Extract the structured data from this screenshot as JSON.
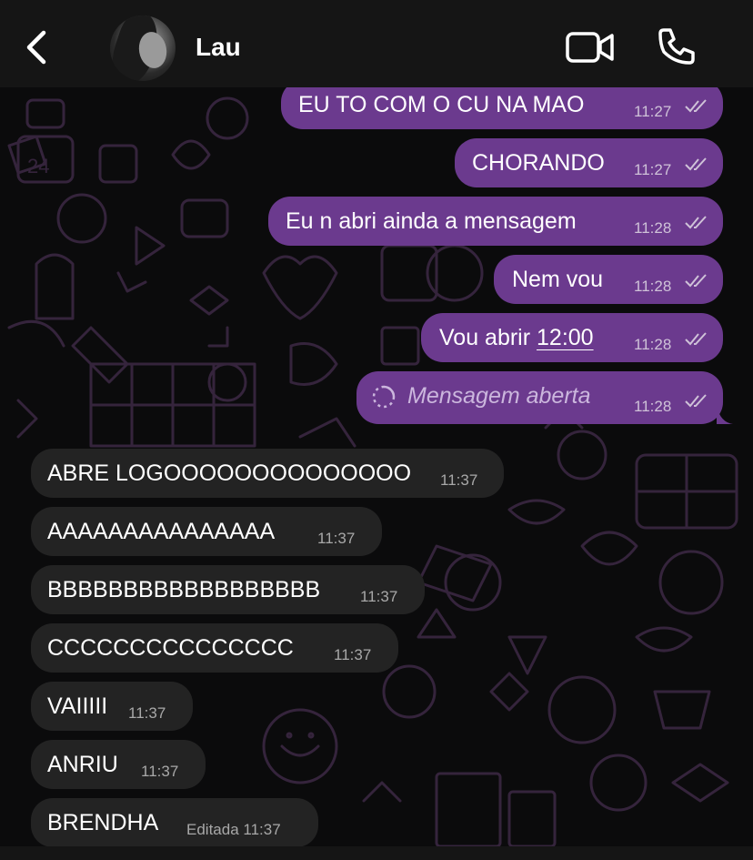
{
  "header": {
    "contact_name": "Lau",
    "back_icon": "chevron-left-icon",
    "video_icon": "video-camera-icon",
    "call_icon": "phone-icon"
  },
  "colors": {
    "outgoing_bubble": "#6b3a8e",
    "incoming_bubble": "#232323",
    "background": "#0b0b0c",
    "wallpaper_doodle": "#3a2742"
  },
  "messages_out": [
    {
      "text": "EU TO COM O CU NA MAO",
      "time": "11:27"
    },
    {
      "text": "CHORANDO",
      "time": "11:27"
    },
    {
      "text": "Eu n abri ainda a mensagem",
      "time": "11:28"
    },
    {
      "text": "Nem vou",
      "time": "11:28"
    },
    {
      "text_prefix": "Vou abrir ",
      "text_link": "12:00",
      "time": "11:28"
    },
    {
      "text": "Mensagem aberta",
      "time": "11:28"
    }
  ],
  "messages_in": [
    {
      "text": "ABRE LOGOOOOOOOOOOOOOO",
      "time": "11:37"
    },
    {
      "text": "AAAAAAAAAAAAAAA",
      "time": "11:37"
    },
    {
      "text": "BBBBBBBBBBBBBBBBBB",
      "time": "11:37"
    },
    {
      "text": "CCCCCCCCCCCCCCC",
      "time": "11:37"
    },
    {
      "text": "VAIIIII",
      "time": "11:37"
    },
    {
      "text": "ANRIU",
      "time": "11:37"
    },
    {
      "text": "BRENDHA",
      "time": "Editada 11:37"
    }
  ]
}
